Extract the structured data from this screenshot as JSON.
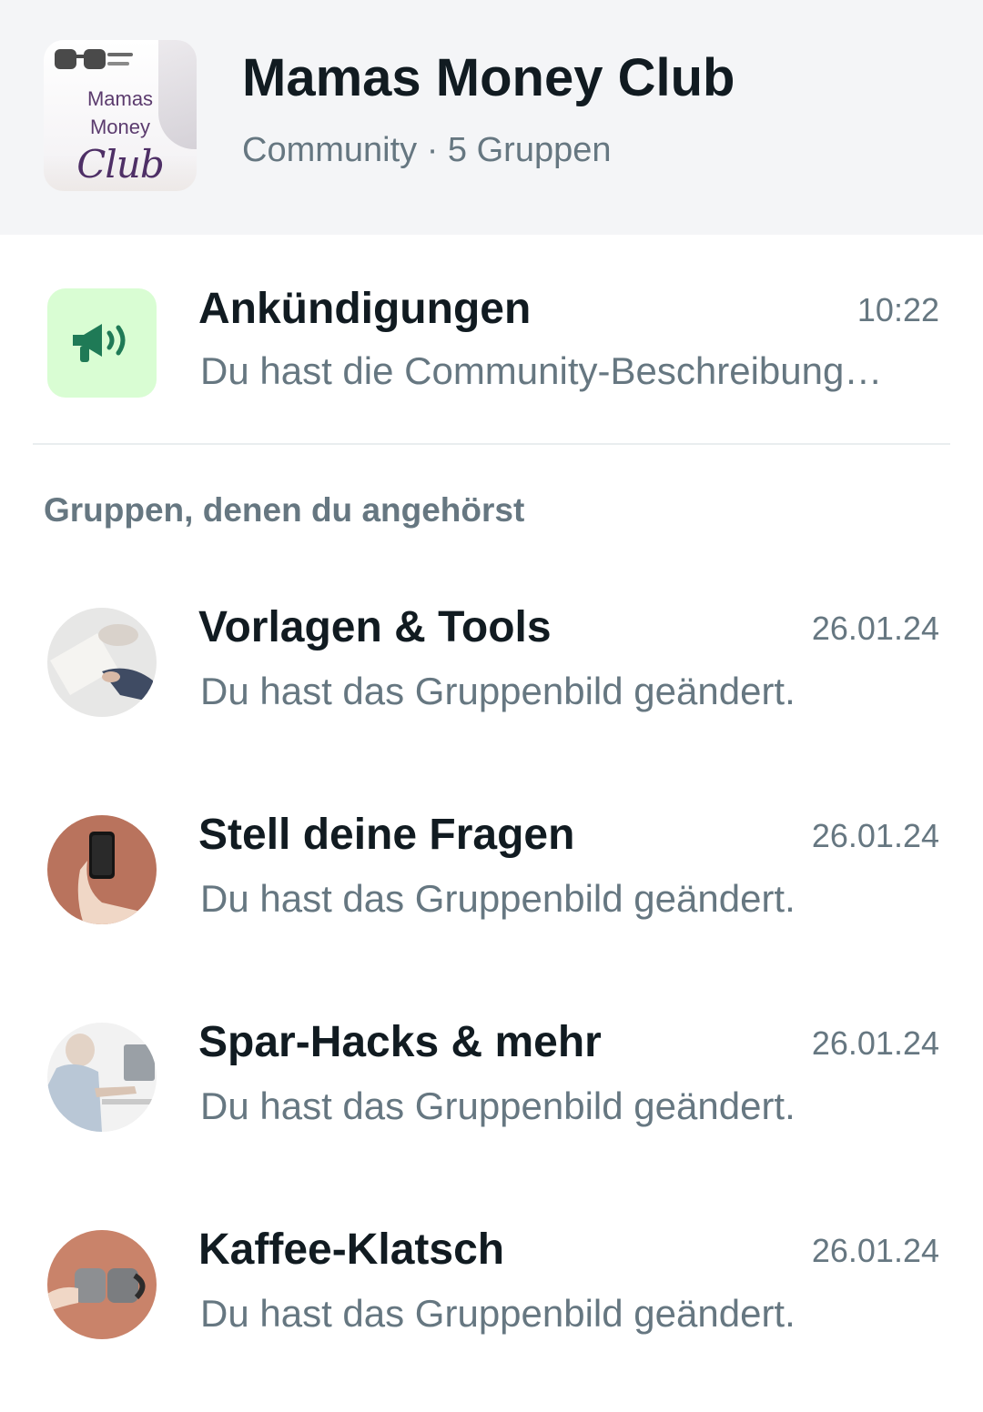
{
  "community": {
    "logo_text": [
      "Mamas",
      "Money",
      "Club"
    ],
    "title": "Mamas Money Club",
    "subtitle": "Community · 5 Gruppen"
  },
  "announcements": {
    "icon": "megaphone-icon",
    "title": "Ankündigungen",
    "time": "10:22",
    "preview": "Du hast die Community-Beschreibung…"
  },
  "groups_section_label": "Gruppen, denen du angehörst",
  "groups": [
    {
      "title": "Vorlagen & Tools",
      "time": "26.01.24",
      "preview": "Du hast das Gruppenbild geändert."
    },
    {
      "title": "Stell deine Fragen",
      "time": "26.01.24",
      "preview": "Du hast das Gruppenbild geändert."
    },
    {
      "title": "Spar-Hacks & mehr",
      "time": "26.01.24",
      "preview": "Du hast das Gruppenbild geändert."
    },
    {
      "title": "Kaffee-Klatsch",
      "time": "26.01.24",
      "preview": "Du hast das Gruppenbild geändert."
    }
  ],
  "colors": {
    "header_bg": "#f4f5f7",
    "announce_icon_bg": "#d9fdd3",
    "announce_icon_fg": "#1f7a56",
    "secondary_text": "#667781"
  }
}
